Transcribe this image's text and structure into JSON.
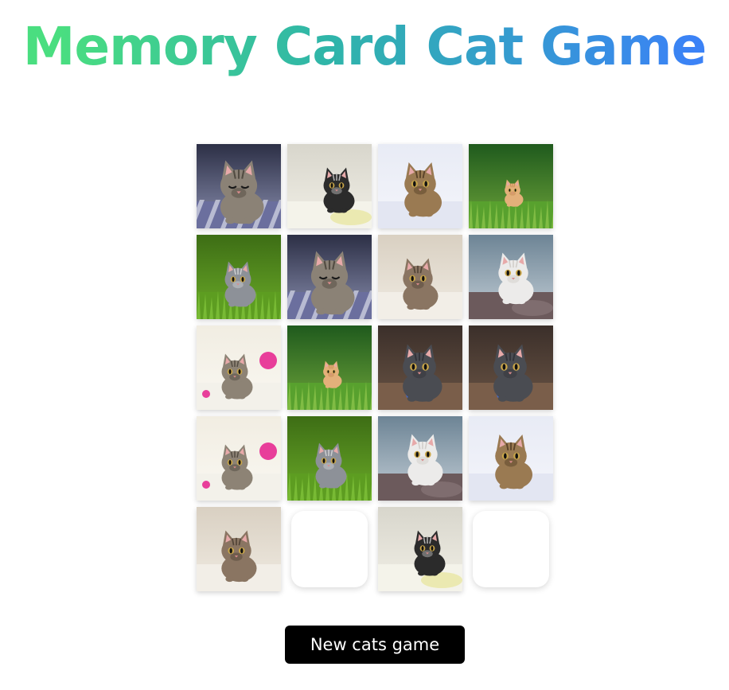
{
  "title": "Memory Card Cat Game",
  "new_game_label": "New cats game",
  "colors": {
    "title_gradient_start": "#4ade80",
    "title_gradient_mid": "#2fb5a9",
    "title_gradient_end": "#3b82f6",
    "button_background": "#000000",
    "button_text": "#ffffff",
    "face_down_card": "#ffffff"
  },
  "board": {
    "columns": 4,
    "rows": 5,
    "cards": [
      {
        "state": "face-up",
        "cat": "tabby-kitten-sleeping-blanket"
      },
      {
        "state": "face-up",
        "cat": "black-white-kitten-bed"
      },
      {
        "state": "face-up",
        "cat": "brown-tabby-kitten-white-bg"
      },
      {
        "state": "face-up",
        "cat": "orange-kitten-in-grass"
      },
      {
        "state": "face-up",
        "cat": "grey-kitten-walking-grass"
      },
      {
        "state": "face-up",
        "cat": "tabby-kitten-sleeping-blanket"
      },
      {
        "state": "face-up",
        "cat": "tabby-kitten-lying-cream"
      },
      {
        "state": "face-up",
        "cat": "white-fluffy-kitten-sofa"
      },
      {
        "state": "face-up",
        "cat": "tabby-kitten-pink-toy"
      },
      {
        "state": "face-up",
        "cat": "orange-kitten-in-grass"
      },
      {
        "state": "face-up",
        "cat": "grey-kitten-blue-ball"
      },
      {
        "state": "face-up",
        "cat": "grey-kitten-blue-ball"
      },
      {
        "state": "face-up",
        "cat": "tabby-kitten-pink-toy"
      },
      {
        "state": "face-up",
        "cat": "grey-kitten-walking-grass"
      },
      {
        "state": "face-up",
        "cat": "white-fluffy-kitten-sofa"
      },
      {
        "state": "face-up",
        "cat": "brown-tabby-kitten-white-bg"
      },
      {
        "state": "face-up",
        "cat": "tabby-kitten-lying-cream"
      },
      {
        "state": "face-down",
        "cat": ""
      },
      {
        "state": "face-up",
        "cat": "black-white-kitten-bed"
      },
      {
        "state": "face-down",
        "cat": ""
      }
    ]
  }
}
